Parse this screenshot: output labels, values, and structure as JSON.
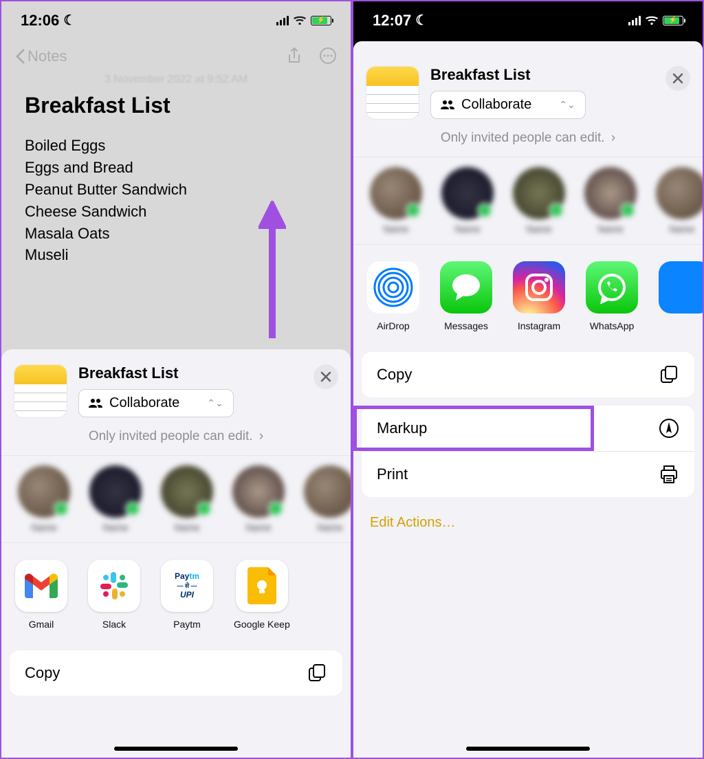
{
  "left": {
    "time": "12:06",
    "nav_back": "Notes",
    "note_date": "3 November 2022 at 9:52 AM",
    "title": "Breakfast List",
    "items": [
      "Boiled Eggs",
      "Eggs and Bread",
      "Peanut Butter Sandwich",
      "Cheese Sandwich",
      "Masala Oats",
      "Museli"
    ],
    "sheet": {
      "title": "Breakfast List",
      "collab": "Collaborate",
      "sub": "Only invited people can edit.",
      "apps": [
        "Gmail",
        "Slack",
        "Paytm",
        "Google Keep"
      ],
      "copy": "Copy"
    }
  },
  "right": {
    "time": "12:07",
    "sheet": {
      "title": "Breakfast List",
      "collab": "Collaborate",
      "sub": "Only invited people can edit.",
      "apps": [
        "AirDrop",
        "Messages",
        "Instagram",
        "WhatsApp"
      ],
      "actions": {
        "copy": "Copy",
        "markup": "Markup",
        "print": "Print"
      },
      "edit": "Edit Actions…"
    }
  }
}
